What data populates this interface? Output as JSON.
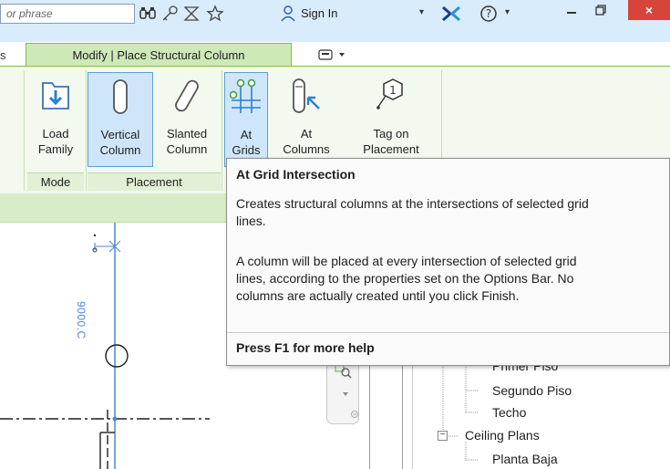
{
  "titlebar": {
    "search_placeholder": "or phrase",
    "sign_in_label": "Sign In",
    "help_label": "?",
    "close_label": "×"
  },
  "tabs": {
    "previous_tab": "s",
    "active_tab": "Modify | Place Structural Column"
  },
  "ribbon": {
    "buttons": {
      "load_family": "Load\nFamily",
      "vertical_column": "Vertical\nColumn",
      "slanted_column": "Slanted\nColumn",
      "at_grids": "At\nGrids",
      "at_columns": "At\nColumns",
      "tag_on_placement": "Tag on\nPlacement"
    },
    "groups": {
      "mode": "Mode",
      "placement": "Placement"
    }
  },
  "canvas": {
    "dimension_text": "9000.C"
  },
  "project_browser": {
    "items": [
      "Primer Piso",
      "Segundo Piso",
      "Techo",
      "Ceiling Plans",
      "Planta Baja"
    ]
  },
  "tooltip": {
    "title": "At Grid Intersection",
    "description": "Creates structural columns at the intersections of selected grid\nlines.",
    "details": "A column will be placed at every intersection of selected grid\nlines, according to the properties set on the Options Bar. No\ncolumns are actually created until you click Finish.",
    "help": "Press F1 for more help"
  },
  "colors": {
    "accent_green": "#7cbf4a",
    "selected_blue": "#5aa0db",
    "close_red": "#d7453a"
  }
}
